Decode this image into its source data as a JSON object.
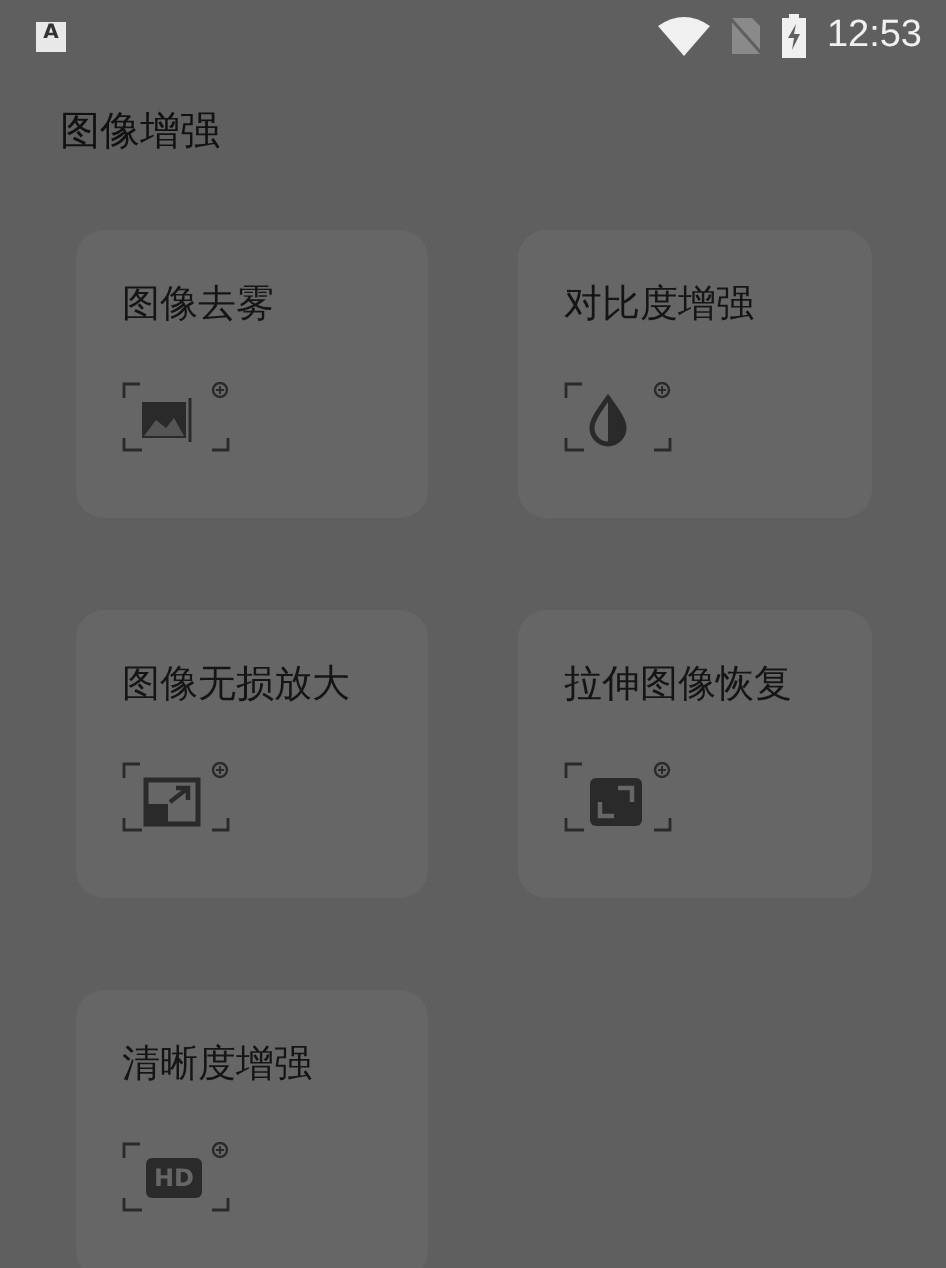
{
  "status_bar": {
    "notification_glyph": "A",
    "time": "12:53"
  },
  "page_title": "图像增强",
  "tools": [
    {
      "label": "图像去雾",
      "kind": "dehaze"
    },
    {
      "label": "对比度增强",
      "kind": "contrast"
    },
    {
      "label": "图像无损放大",
      "kind": "enlarge"
    },
    {
      "label": "拉伸图像恢复",
      "kind": "restore"
    },
    {
      "label": "清晰度增强",
      "kind": "hd",
      "icon_text": "HD"
    }
  ]
}
